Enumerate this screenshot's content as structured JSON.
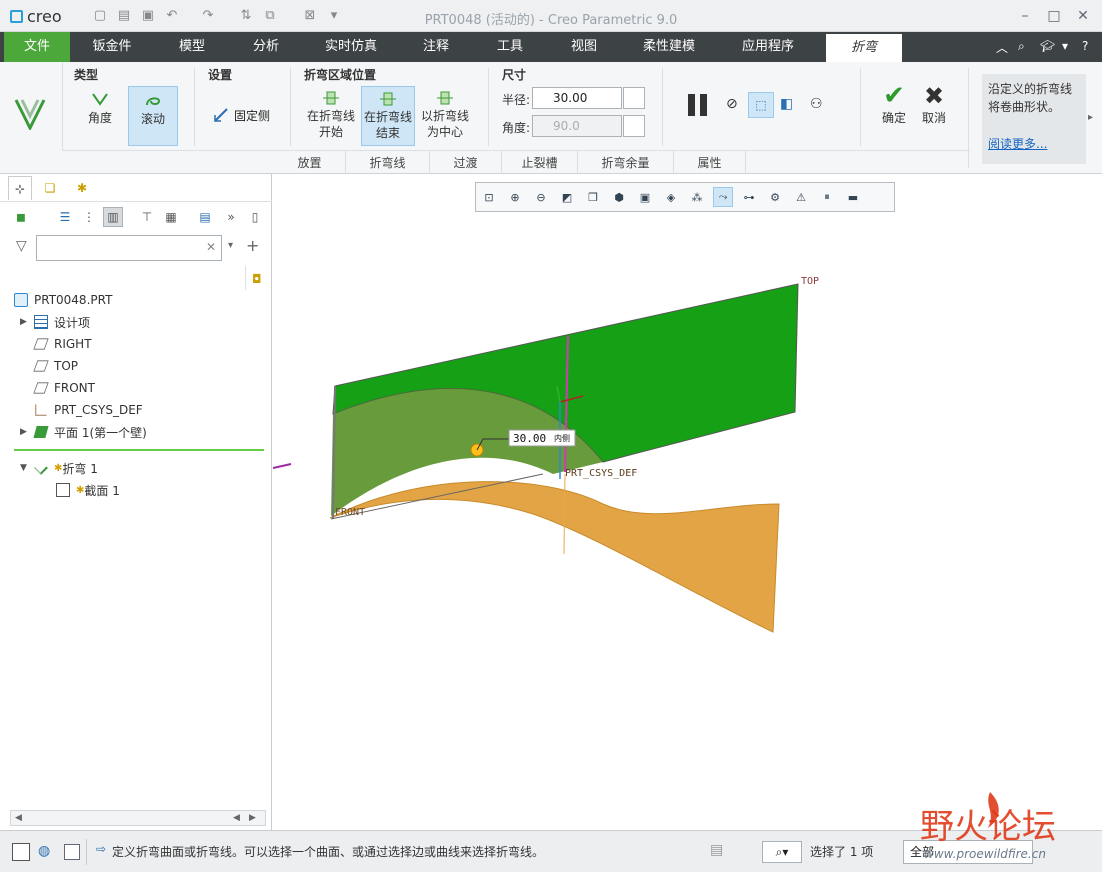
{
  "app": {
    "logo_text": "creo",
    "window_title": "PRT0048 (活动的) - Creo Parametric 9.0"
  },
  "menu": {
    "file": "文件",
    "tabs": [
      "钣金件",
      "模型",
      "分析",
      "实时仿真",
      "注释",
      "工具",
      "视图",
      "柔性建模",
      "应用程序"
    ],
    "active_tab": "折弯"
  },
  "ribbon": {
    "type_group": {
      "title": "类型",
      "angle": "角度",
      "roll": "滚动"
    },
    "settings_group": {
      "title": "设置",
      "fixed_side": "固定侧"
    },
    "bend_region_group": {
      "title": "折弯区域位置",
      "start": [
        "在折弯线",
        "开始"
      ],
      "end": [
        "在折弯线",
        "结束"
      ],
      "center": [
        "以折弯线",
        "为中心"
      ]
    },
    "dimensions_group": {
      "title": "尺寸",
      "radius_label": "半径:",
      "radius_value": "30.00",
      "angle_label": "角度:",
      "angle_value": "90.0"
    },
    "confirm": "确定",
    "cancel": "取消",
    "help_text": "沿定义的折弯线将卷曲形状。",
    "help_link": "阅读更多...",
    "bottom_tabs": [
      "放置",
      "折弯线",
      "过渡",
      "止裂槽",
      "折弯余量",
      "属性"
    ]
  },
  "model_tree": {
    "root": "PRT0048.PRT",
    "items": [
      {
        "label": "设计项",
        "icon": "design-items-icon",
        "expandable": true
      },
      {
        "label": "RIGHT",
        "icon": "datum-plane-icon",
        "expandable": false
      },
      {
        "label": "TOP",
        "icon": "datum-plane-icon",
        "expandable": false
      },
      {
        "label": "FRONT",
        "icon": "datum-plane-icon",
        "expandable": false
      },
      {
        "label": "PRT_CSYS_DEF",
        "icon": "csys-icon",
        "expandable": false
      },
      {
        "label": "平面 1(第一个壁)",
        "icon": "flat-wall-icon",
        "expandable": true
      }
    ],
    "insert_items": [
      {
        "label": "折弯 1",
        "icon": "bend-feature-icon",
        "new": true
      },
      {
        "label": "截面 1",
        "icon": "sketch-icon",
        "new": true
      }
    ],
    "search_placeholder": ""
  },
  "viewport": {
    "labels": {
      "top": "TOP",
      "front": "FRONT",
      "csys": "PRT_CSYS_DEF",
      "dim": "30.00",
      "dim_suffix": "内侧"
    }
  },
  "status": {
    "message": "定义折弯曲面或折弯线。可以选择一个曲面、或通过选择边或曲线来选择折弯线。",
    "selection": "选择了 1 项",
    "filter": "全部"
  },
  "watermark": {
    "text": "野火论坛",
    "url": "www.proewildfire.cn"
  },
  "colors": {
    "file_tab": "#4ca83a",
    "menu_bar": "#3d4245",
    "wall_green": "#1ea01e",
    "bend_orange": "#e8a848"
  }
}
